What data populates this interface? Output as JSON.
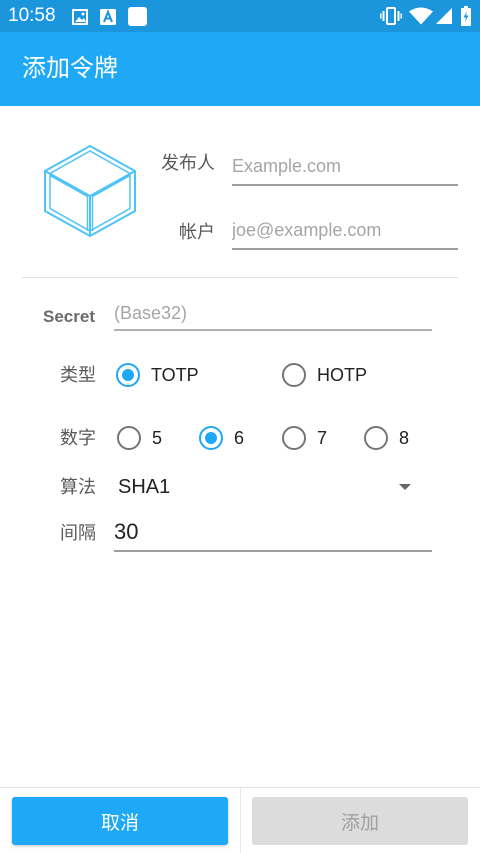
{
  "status_bar": {
    "time": "10:58",
    "left_icons": [
      "gallery-notification-icon",
      "a-notification-icon",
      "app-notification-icon"
    ],
    "right_icons": [
      "vibrate-icon",
      "wifi-icon",
      "cell-signal-icon",
      "battery-charging-icon"
    ]
  },
  "toolbar": {
    "title": "添加令牌"
  },
  "form": {
    "token_icon": "cube-icon",
    "issuer": {
      "label": "发布人",
      "value": "",
      "placeholder": "Example.com"
    },
    "account": {
      "label": "帐户",
      "value": "",
      "placeholder": "joe@example.com"
    },
    "secret": {
      "label": "Secret",
      "value": "",
      "placeholder": "(Base32)"
    },
    "type": {
      "label": "类型",
      "options": [
        {
          "label": "TOTP",
          "checked": true
        },
        {
          "label": "HOTP",
          "checked": false
        }
      ]
    },
    "digits": {
      "label": "数字",
      "options": [
        {
          "label": "5",
          "checked": false
        },
        {
          "label": "6",
          "checked": true
        },
        {
          "label": "7",
          "checked": false
        },
        {
          "label": "8",
          "checked": false
        }
      ]
    },
    "algorithm": {
      "label": "算法",
      "selected": "SHA1"
    },
    "interval": {
      "label": "间隔",
      "value": "30"
    }
  },
  "buttons": {
    "cancel": {
      "label": "取消",
      "enabled": true
    },
    "add": {
      "label": "添加",
      "enabled": false
    }
  },
  "colors": {
    "status_bar": "#1b95dc",
    "toolbar": "#1fa8f5",
    "accent": "#1fa8f5",
    "cube": "#4fc3f7",
    "disabled_button": "#dcdcdc",
    "disabled_text": "#a0a0a0"
  }
}
